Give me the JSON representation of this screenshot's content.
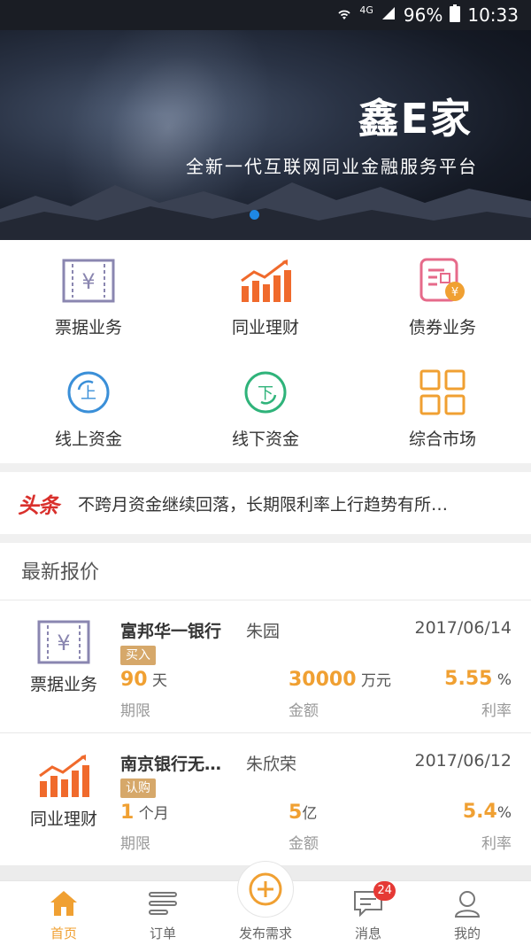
{
  "status_bar": {
    "network": "4G",
    "battery": "96%",
    "time": "10:33"
  },
  "banner": {
    "logo": "鑫E家",
    "slogan": "全新一代互联网同业金融服务平台"
  },
  "menu": [
    {
      "label": "票据业务",
      "icon": "bill-icon"
    },
    {
      "label": "同业理财",
      "icon": "bar-chart-icon"
    },
    {
      "label": "债券业务",
      "icon": "bond-icon"
    },
    {
      "label": "线上资金",
      "icon": "online-funds-icon"
    },
    {
      "label": "线下资金",
      "icon": "offline-funds-icon"
    },
    {
      "label": "综合市场",
      "icon": "grid-icon"
    }
  ],
  "headline": {
    "tag": "头条",
    "text": "不跨月资金继续回落，长期限利率上行趋势有所…"
  },
  "section_title": "最新报价",
  "quotes": [
    {
      "category": "票据业务",
      "bank": "富邦华一银行",
      "person": "朱园",
      "date": "2017/06/14",
      "badge": "买入",
      "term_value": "90",
      "term_unit": " 天",
      "term_caption": "期限",
      "amount_value": "30000",
      "amount_unit": " 万元",
      "amount_caption": "金额",
      "rate_value": "5.55",
      "rate_unit": " %",
      "rate_caption": "利率"
    },
    {
      "category": "同业理财",
      "bank": "南京银行无…",
      "person": "朱欣荣",
      "date": "2017/06/12",
      "badge": "认购",
      "term_value": "1",
      "term_unit": " 个月",
      "term_caption": "期限",
      "amount_value": "5",
      "amount_unit": "亿",
      "amount_caption": "金额",
      "rate_value": "5.4",
      "rate_unit": "%",
      "rate_caption": "利率"
    }
  ],
  "tabbar": {
    "home": "首页",
    "orders": "订单",
    "publish": "发布需求",
    "messages": "消息",
    "messages_count": "24",
    "mine": "我的"
  },
  "colors": {
    "accent": "#f0a032",
    "headline_red": "#d9302c",
    "dot_blue": "#1e88e5"
  }
}
